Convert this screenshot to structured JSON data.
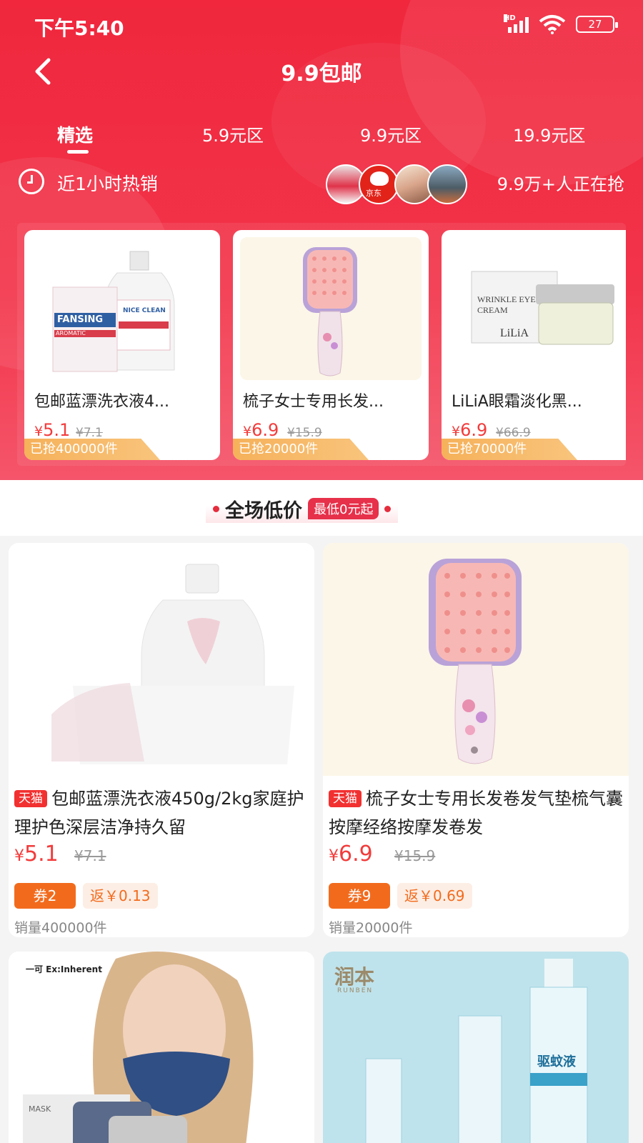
{
  "status_bar": {
    "time": "下午5:40",
    "battery": "27",
    "hd": "HD"
  },
  "title_bar": {
    "title": "9.9包邮"
  },
  "tabs": [
    {
      "label": "精选",
      "active": true
    },
    {
      "label": "5.9元区",
      "active": false
    },
    {
      "label": "9.9元区",
      "active": false
    },
    {
      "label": "19.9元区",
      "active": false
    }
  ],
  "hot_strip": {
    "label": "近1小时热销",
    "avatar_brand": "京东",
    "count": "9.9万+人正在抢"
  },
  "hot_products": [
    {
      "name": "包邮蓝漂洗衣液4...",
      "price_symbol": "¥",
      "price": "5.1",
      "original": "¥7.1",
      "sold": "已抢400000件"
    },
    {
      "name": "梳子女士专用长发...",
      "price_symbol": "¥",
      "price": "6.9",
      "original": "¥15.9",
      "sold": "已抢20000件"
    },
    {
      "name": "LiLiA眼霜淡化黑...",
      "price_symbol": "¥",
      "price": "6.9",
      "original": "¥66.9",
      "sold": "已抢70000件"
    }
  ],
  "hot_product_image_text": {
    "detergent_brand": "FANSING",
    "detergent_tag": "NICE CLEAN",
    "detergent_sub": "AROMATIC",
    "cream_box": "WRINKLE EYE CREAM",
    "cream_brand": "LiLiA"
  },
  "section_banner": {
    "title": "全场低价",
    "badge": "最低0元起"
  },
  "grid_products": [
    {
      "store": "天猫",
      "title": "包邮蓝漂洗衣液450g/2kg家庭护理护色深层洁净持久留",
      "price_symbol": "¥",
      "price": "5.1",
      "original": "¥7.1",
      "coupon": "券2",
      "rebate": "返￥0.13",
      "sales": "销量400000件"
    },
    {
      "store": "天猫",
      "title": "梳子女士专用长发卷发气垫梳气囊按摩经络按摩发卷发",
      "price_symbol": "¥",
      "price": "6.9",
      "original": "¥15.9",
      "coupon": "券9",
      "rebate": "返￥0.69",
      "sales": "销量20000件"
    }
  ],
  "grid_images": {
    "mask_brand": "一可 Ex:Inherent",
    "mask_pack": "MASK",
    "runben_brand": "润本",
    "runben_sub": "RUNBEN",
    "runben_product": "驱蚊液"
  },
  "colors": {
    "header_red": "#f0273d",
    "price_red": "#f33b3b",
    "coupon_orange": "#f26b1d",
    "sold_orange": "#f6b15a"
  }
}
